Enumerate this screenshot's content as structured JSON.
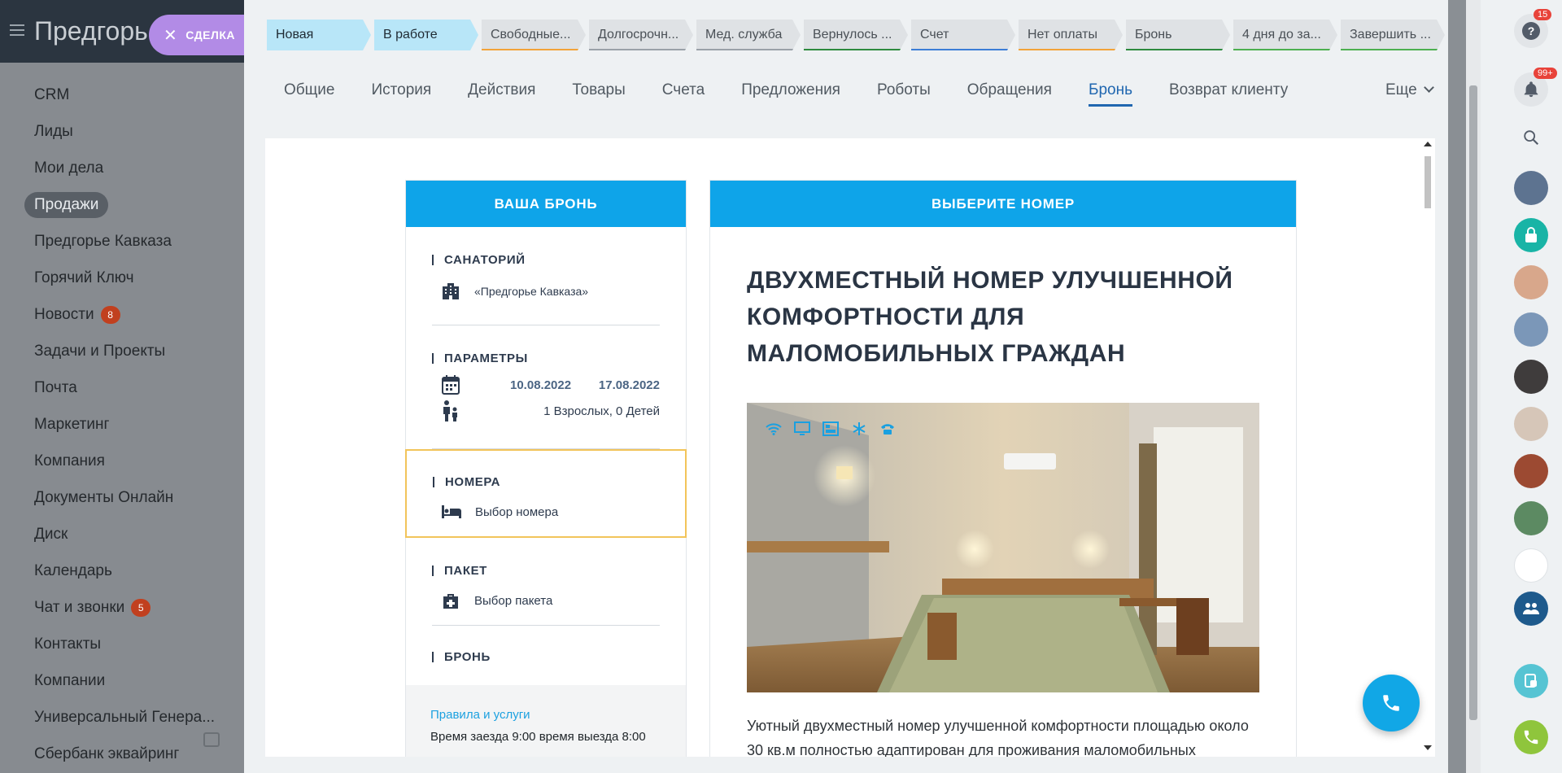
{
  "sidebar": {
    "title": "Предгорь",
    "deal_chip": "СДЕЛКА",
    "items": [
      {
        "label": "CRM"
      },
      {
        "label": "Лиды"
      },
      {
        "label": "Мои дела"
      },
      {
        "label": "Продажи",
        "active": true
      },
      {
        "label": "Предгорье Кавказа"
      },
      {
        "label": "Горячий Ключ"
      },
      {
        "label": "Новости",
        "badge": "8"
      },
      {
        "label": "Задачи и Проекты"
      },
      {
        "label": "Почта"
      },
      {
        "label": "Маркетинг"
      },
      {
        "label": "Компания"
      },
      {
        "label": "Документы Онлайн"
      },
      {
        "label": "Диск"
      },
      {
        "label": "Календарь"
      },
      {
        "label": "Чат и звонки",
        "badge": "5"
      },
      {
        "label": "Контакты"
      },
      {
        "label": "Компании"
      },
      {
        "label": "Универсальный Генера..."
      },
      {
        "label": "Сбербанк эквайринг"
      }
    ]
  },
  "stages": [
    {
      "label": "Новая",
      "color": "#b8e6f8",
      "current": true,
      "width": 128
    },
    {
      "label": "В работе",
      "color": "#b8e6f8",
      "current": true,
      "width": 128
    },
    {
      "label": "Свободные...",
      "color": "#f2a33a",
      "width": 128
    },
    {
      "label": "Долгосрочн...",
      "color": "#9aa1a8",
      "width": 128
    },
    {
      "label": "Мед. служба",
      "color": "#9aa1a8",
      "width": 128
    },
    {
      "label": "Вернулось ...",
      "color": "#2d8a3e",
      "width": 128
    },
    {
      "label": "Счет",
      "color": "#3c7dd6",
      "width": 128
    },
    {
      "label": "Нет оплаты",
      "color": "#f2a33a",
      "width": 128
    },
    {
      "label": "Бронь",
      "color": "#2d8a3e",
      "width": 128
    },
    {
      "label": "4 дня до за...",
      "color": "#4cb050",
      "width": 128
    },
    {
      "label": "Завершить ...",
      "color": "#4cb050",
      "width": 128
    }
  ],
  "tabs": [
    {
      "label": "Общие"
    },
    {
      "label": "История"
    },
    {
      "label": "Действия"
    },
    {
      "label": "Товары"
    },
    {
      "label": "Счета"
    },
    {
      "label": "Предложения"
    },
    {
      "label": "Роботы"
    },
    {
      "label": "Обращения"
    },
    {
      "label": "Бронь",
      "active": true
    },
    {
      "label": "Возврат клиенту"
    }
  ],
  "more_tab": "Еще",
  "booking": {
    "header": "ВАША БРОНЬ",
    "sanatorium_title": "САНАТОРИЙ",
    "sanatorium_name": "«Предгорье Кавказа»",
    "params_title": "ПАРАМЕТРЫ",
    "date_from": "10.08.2022",
    "date_to": "17.08.2022",
    "guests": "1 Взрослых, 0 Детей",
    "rooms_title": "НОМЕРА",
    "rooms_value": "Выбор номера",
    "package_title": "ПАКЕТ",
    "package_value": "Выбор пакета",
    "reservation_title": "БРОНЬ",
    "rules_link": "Правила и услуги",
    "rules_text": "Время заезда 9:00 время выезда 8:00"
  },
  "room": {
    "header": "ВЫБЕРИТЕ НОМЕР",
    "title": "ДВУХМЕСТНЫЙ НОМЕР УЛУЧШЕННОЙ КОМФОРТНОСТИ ДЛЯ МАЛОМОБИЛЬНЫХ ГРАЖДАН",
    "description": "Уютный двухместный номер улучшенной комфортности площадью около 30 кв.м полностью адаптирован для проживания маломобильных",
    "amenity_icons": [
      "wifi-icon",
      "tv-icon",
      "bed-icon",
      "snowflake-icon",
      "phone-icon"
    ]
  },
  "rail": {
    "help_badge": "15",
    "notifications_badge": "99+"
  },
  "colors": {
    "accent_blue": "#0ea4e9",
    "active_tab": "#2067b0",
    "highlight_border": "#f2c45a",
    "badge_red": "#c1401f"
  }
}
